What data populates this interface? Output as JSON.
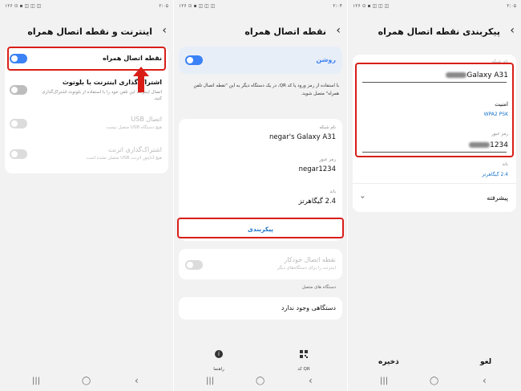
{
  "status": {
    "p1_time": "۲:۰۵",
    "p1_left": "۱۲۶ ⊙ ▪ ◫ ◫ ◫",
    "p2_time": "۲:۰۴",
    "p2_left": "۱۲۶ ⊙ ▪ ◫ ◫ ◫",
    "p3_time": "۲:۰۵",
    "p3_left": "۱۲۶ ⊙ ▪ ◫ ◫ ◫"
  },
  "panel1": {
    "title": "اینترنت و نقطه اتصال همراه",
    "hotspot_label": "نقطه اتصال همراه",
    "bt_label": "اشتراک‌گذاری اینترنت با بلوتوث",
    "bt_desc": "اتصال اینترنت این تلفن خود را با استفاده از بلوتوث اشتراک‌گذاری کنید.",
    "usb_label": "اتصال USB",
    "usb_desc": "هیچ دستگاه USB متصل نیست",
    "eth_label": "اشتراک‌گذاری اترنت",
    "eth_desc": "هیچ آداپتور اترنت USB متصل نشده است"
  },
  "panel2": {
    "title": "نقطه اتصال همراه",
    "on_label": "روشن",
    "info": "با استفاده از رمز ورود یا کد QR، در یک دستگاه دیگر به این \"نقطه اتصال تلفن همراه\" متصل شوید.",
    "network_name_label": "نام شبکه",
    "network_name": "negar's Galaxy A31",
    "password_label": "رمز عبور",
    "password": "negar1234",
    "band_label": "باند",
    "band": "2.4 گیگاهرتز",
    "configure": "پیکربندی",
    "auto_label": "نقطه اتصال خودکار",
    "auto_desc": "اینترنت را برای دستگاه‌های دیگر",
    "connected_label": "دستگاه های متصل",
    "no_device": "دستگاهی وجود ندارد",
    "qr_label": "کد QR",
    "help_label": "راهنما"
  },
  "panel3": {
    "title": "پیکربندی نقطه اتصال همراه",
    "name_label": "نام شبکه",
    "name_value": "Galaxy A31",
    "security_label": "امنیت",
    "security_value": "WPA2 PSK",
    "password_label": "رمز عبور",
    "password_value": "1234",
    "band_label": "باند",
    "band_value": "2.4 گیگاهرتز",
    "advanced": "پیشرفته",
    "save": "ذخیره",
    "cancel": "لغو"
  },
  "nav": {
    "recent": "|||",
    "home": "◯",
    "back": "‹"
  },
  "colors": {
    "accent": "#3b82f6",
    "highlight": "#d91e18",
    "link": "#1a73c8"
  }
}
